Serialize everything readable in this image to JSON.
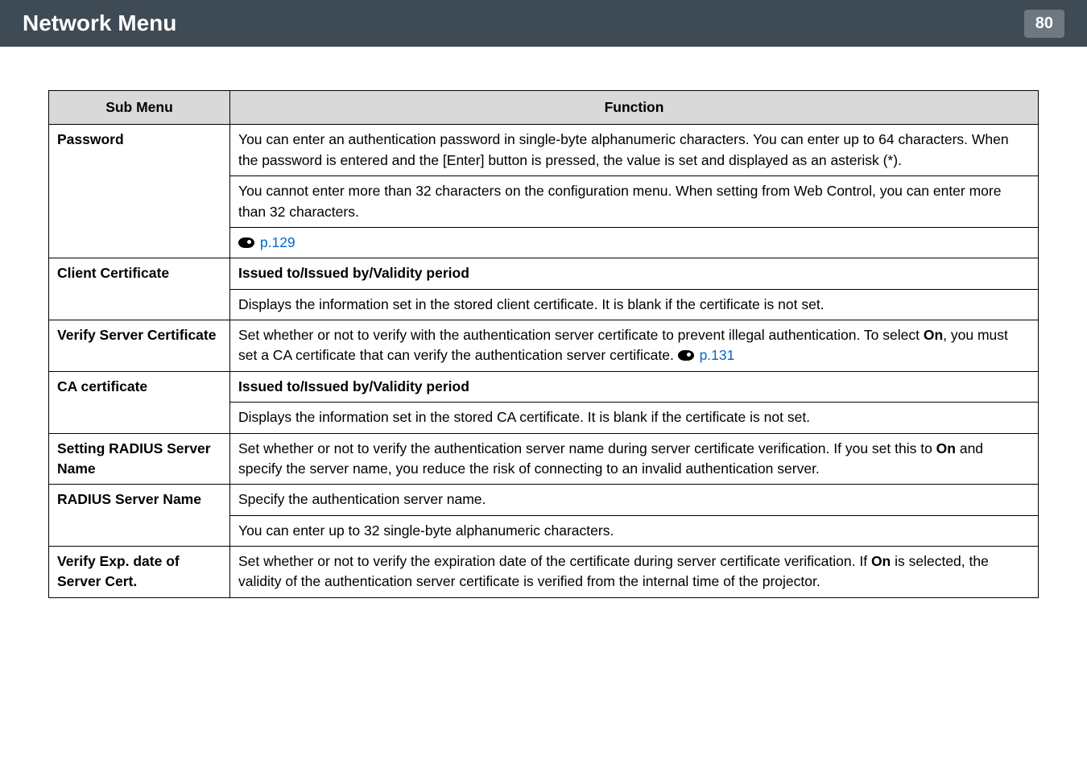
{
  "header": {
    "title": "Network Menu",
    "page_number": "80"
  },
  "table": {
    "headers": {
      "sub_menu": "Sub Menu",
      "function": "Function"
    },
    "rows": {
      "password": {
        "label": "Password",
        "para1": "You can enter an authentication password in single-byte alphanumeric characters. You can enter up to 64 characters. When the password is entered and the [Enter] button is pressed, the value is set and displayed as an asterisk (*).",
        "para2": "You cannot enter more than 32 characters on the configuration menu. When setting from Web Control, you can enter more than 32 characters.",
        "link1": "p.129"
      },
      "client_cert": {
        "label": "Client Certificate",
        "bold_line": "Issued to/Issued by/Validity period",
        "para1": "Displays the information set in the stored client certificate. It is blank if the certificate is not set."
      },
      "verify_server_cert": {
        "label": "Verify Server Certificate",
        "para1_pre": "Set whether or not to verify with the authentication server certificate to prevent illegal authentication. To select ",
        "on": "On",
        "para1_post": ", you must set a CA certificate that can verify the authentication server certificate. ",
        "link": "p.131"
      },
      "ca_cert": {
        "label": "CA certificate",
        "bold_line": "Issued to/Issued by/Validity period",
        "para1": "Displays the information set in the stored CA certificate. It is blank if the certificate is not set."
      },
      "setting_radius": {
        "label": "Setting RADIUS Server Name",
        "para1_pre": "Set whether or not to verify the authentication server name during server certificate verification. If you set this to ",
        "on": "On",
        "para1_post": " and specify the server name, you reduce the risk of connecting to an invalid authentication server."
      },
      "radius_name": {
        "label": "RADIUS Server Name",
        "para1": "Specify the authentication server name.",
        "para2": "You can enter up to 32 single-byte alphanumeric characters."
      },
      "verify_exp": {
        "label": "Verify Exp. date of Server Cert.",
        "para1_pre": "Set whether or not to verify the expiration date of the certificate during server certificate verification. If ",
        "on": "On",
        "para1_post": " is selected, the validity of the authentication server certificate is verified from the internal time of the projector."
      }
    }
  }
}
